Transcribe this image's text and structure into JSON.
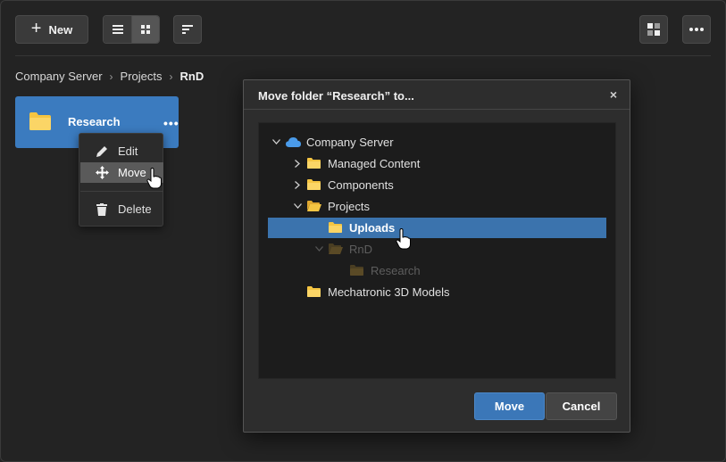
{
  "toolbar": {
    "new_label": "New",
    "icons": [
      "plus-icon",
      "list-view-icon",
      "grid-view-icon",
      "sort-icon",
      "layout-icon",
      "more-icon"
    ]
  },
  "breadcrumb": {
    "items": [
      "Company Server",
      "Projects",
      "RnD"
    ]
  },
  "folder_tile": {
    "name": "Research",
    "more": "•••",
    "color": "#3b7bbf"
  },
  "context_menu": {
    "items": [
      {
        "label": "Edit",
        "icon": "pencil-icon"
      },
      {
        "label": "Move",
        "icon": "move-icon",
        "hovered": true
      },
      {
        "label": "Delete",
        "icon": "trash-icon"
      }
    ]
  },
  "dialog": {
    "title": "Move folder “Research” to...",
    "close": "×",
    "tree": [
      {
        "label": "Company Server",
        "icon": "cloud-icon",
        "expanded": true,
        "level": 0
      },
      {
        "label": "Managed Content",
        "icon": "folder-icon",
        "expanded": false,
        "level": 1
      },
      {
        "label": "Components",
        "icon": "folder-icon",
        "expanded": false,
        "level": 1
      },
      {
        "label": "Projects",
        "icon": "folder-open-icon",
        "expanded": true,
        "level": 1
      },
      {
        "label": "Uploads",
        "icon": "folder-icon",
        "level": 2,
        "selected": true
      },
      {
        "label": "RnD",
        "icon": "folder-open-icon",
        "expanded": true,
        "level": 2,
        "disabled": true
      },
      {
        "label": "Research",
        "icon": "folder-icon",
        "level": 3,
        "disabled": true
      },
      {
        "label": "Mechatronic 3D Models",
        "icon": "folder-icon",
        "level": 1
      }
    ],
    "move_label": "Move",
    "cancel_label": "Cancel"
  },
  "colors": {
    "accent": "#3b77b8",
    "folder": "#f5c542",
    "background": "#232323"
  }
}
